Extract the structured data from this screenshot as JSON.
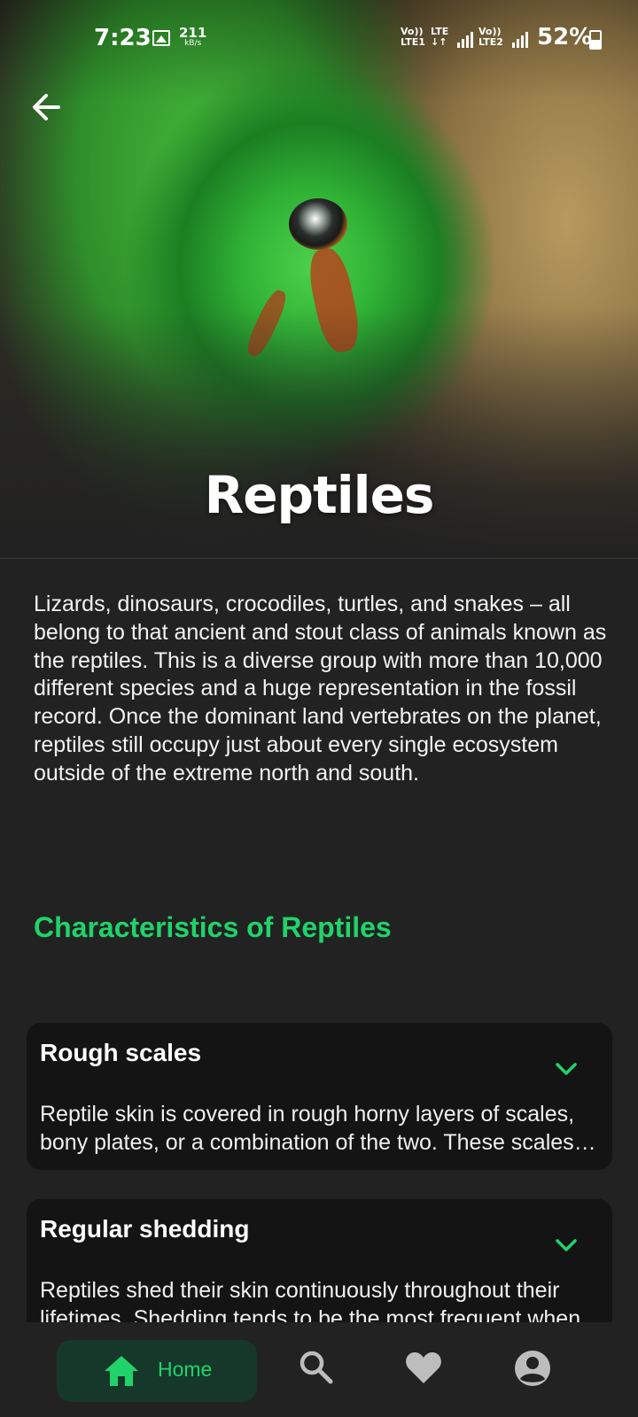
{
  "status_bar": {
    "time": "7:23",
    "speed_value": "211",
    "speed_unit": "kB/s",
    "net1_top": "Vo))",
    "net1_bottom": "LTE1",
    "net2_top": "LTE",
    "net2_bottom": "↓↑",
    "net3_top": "Vo))",
    "net3_bottom": "LTE2",
    "battery": "52%"
  },
  "hero": {
    "title": "Reptiles"
  },
  "intro_text": "Lizards, dinosaurs, crocodiles, turtles, and snakes – all belong to that ancient and stout class of animals known as the reptiles. This is a diverse group with more than 10,000 different species and a huge representation in the fossil record. Once the dominant land vertebrates on the planet, reptiles still occupy just about every single ecosystem outside of the extreme north and south.",
  "section_title": "Characteristics of Reptiles",
  "cards": [
    {
      "title": "Rough scales",
      "body": " Reptile skin is covered in rough horny layers of scales, bony plates, or a combination of the two. These scales protect reptiles from predators and help them retain moisture."
    },
    {
      "title": "Regular shedding",
      "body": "Reptiles shed their skin continuously throughout their lifetimes. Shedding tends to be the most frequent when the animal is young and growing."
    }
  ],
  "nav": {
    "home_label": "Home",
    "items": [
      "home-icon",
      "search-icon",
      "heart-icon",
      "account-icon"
    ]
  },
  "colors": {
    "accent": "#20d36a",
    "background": "#222222",
    "card": "#141414",
    "nav_active_bg": "#15382a"
  }
}
